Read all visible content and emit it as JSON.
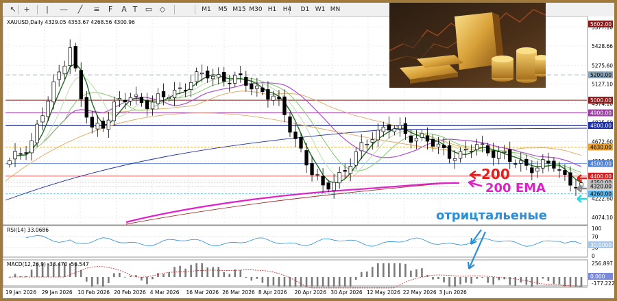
{
  "toolbar": {
    "timeframes": [
      "M1",
      "M5",
      "M15",
      "M30",
      "H1",
      "H4",
      "D1",
      "W1",
      "MN"
    ],
    "icons": [
      "cursor-icon",
      "crosshair-icon",
      "vertical-line-icon",
      "horizontal-line-icon",
      "trendline-icon",
      "channel-icon",
      "fibonacci-icon",
      "text-icon",
      "text-label-icon",
      "rectangle-icon",
      "shapes-icon"
    ]
  },
  "chart": {
    "symbol_info": "XAUUSD,Daily  4329.05 4353.67 4268.56 4300.96",
    "price_axis_labels": [
      "5577.10",
      "5428.66",
      "5275.60",
      "5127.10",
      "4974.10",
      "4825.60",
      "4672.60",
      "4519.60",
      "4366.60",
      "4222.60",
      "4074.10"
    ],
    "price_tags": [
      {
        "text": "5602.00",
        "color": "#8b1a1a"
      },
      {
        "text": "5200.00",
        "color": "#8aa3b8"
      },
      {
        "text": "5000.00",
        "color": "#8b1a1a"
      },
      {
        "text": "4900.00",
        "color": "#9b3fa3"
      },
      {
        "text": "4800.00",
        "color": "#1c2ea8"
      },
      {
        "text": "4630.00",
        "color": "#e8a035"
      },
      {
        "text": "4500.00",
        "color": "#4a7fd4"
      },
      {
        "text": "4400.00",
        "color": "#d42020"
      },
      {
        "text": "4350.00",
        "color": "#c0c0c0"
      },
      {
        "text": "4320.00",
        "color": "#c0c0c0"
      },
      {
        "text": "4260.00",
        "color": "#5ab4e8"
      }
    ],
    "annotations": {
      "level_label": "200",
      "ema_label": "200 EMA",
      "comment": "отрицтальеные"
    },
    "colors": {
      "red": "#e0201c",
      "magenta": "#e020c8",
      "gray": "#8a8a8a",
      "cyan": "#28d8e0",
      "blue": "#2a8fd8"
    }
  },
  "rsi": {
    "label": "RSI(14) 33.0686",
    "axis_labels": [
      "100",
      "70",
      "30",
      "0"
    ],
    "current_tag": "30.0000"
  },
  "macd": {
    "label": "MACD(12,26,9) -33.470 -56.547",
    "axis_labels": [
      "256.897",
      "0.000",
      "-177.222"
    ]
  },
  "date_axis": [
    "19 Jan 2026",
    "29 Jan 2026",
    "10 Feb 2026",
    "20 Feb 2026",
    "4 Mar 2026",
    "16 Mar 2026",
    "26 Mar 2026",
    "8 Apr 2026",
    "20 Apr 2026",
    "30 Apr 2026",
    "12 May 2026",
    "22 May 2026",
    "3 Jun 2026"
  ]
}
